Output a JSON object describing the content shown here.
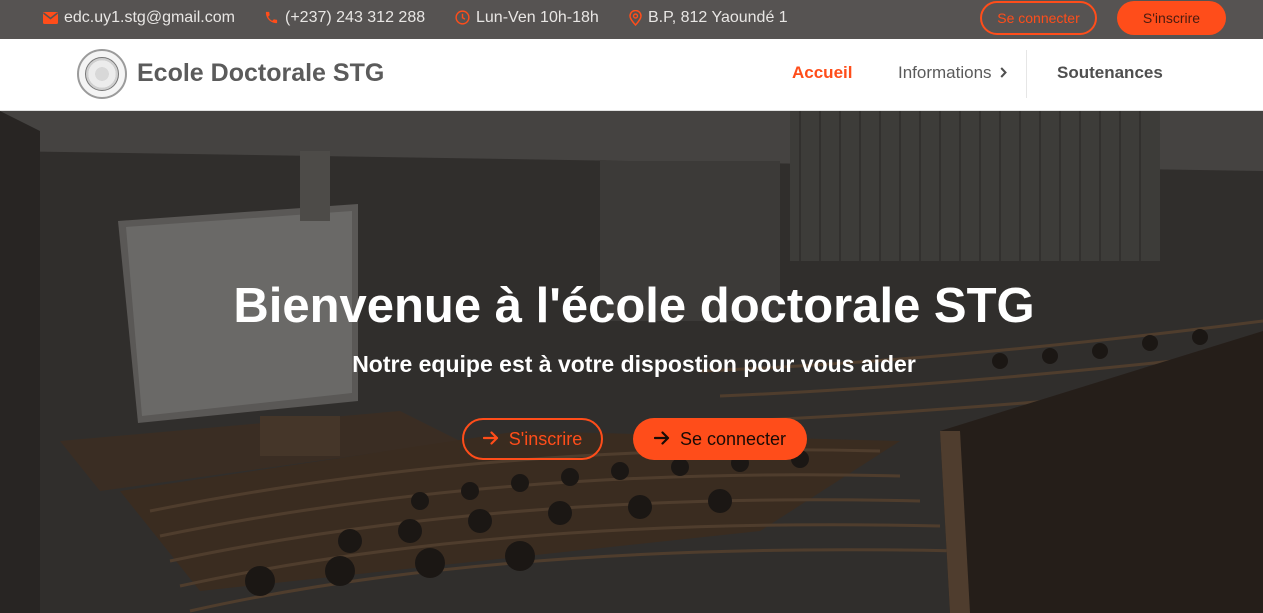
{
  "topbar": {
    "email": "edc.uy1.stg@gmail.com",
    "phone": "(+237) 243 312 288",
    "hours": "Lun-Ven 10h-18h",
    "address": "B.P, 812 Yaoundé 1",
    "login_label": "Se connecter",
    "register_label": "S'inscrire",
    "icons": [
      "envelope-icon",
      "phone-icon",
      "clock-icon",
      "map-pin-icon"
    ]
  },
  "navbar": {
    "brand": "Ecole Doctorale STG",
    "items": [
      {
        "label": "Accueil",
        "active": true
      },
      {
        "label": "Informations",
        "has_submenu": true
      },
      {
        "label": "Soutenances"
      }
    ]
  },
  "hero": {
    "title": "Bienvenue à l'école doctorale STG",
    "subtitle": "Notre equipe est à votre dispostion pour vous aider",
    "register_label": "S'inscrire",
    "login_label": "Se connecter"
  },
  "colors": {
    "accent": "#ff4d1a",
    "topbar_bg": "#565352",
    "navbar_bg": "#ffffff",
    "brand_text": "#5b5b5b"
  }
}
